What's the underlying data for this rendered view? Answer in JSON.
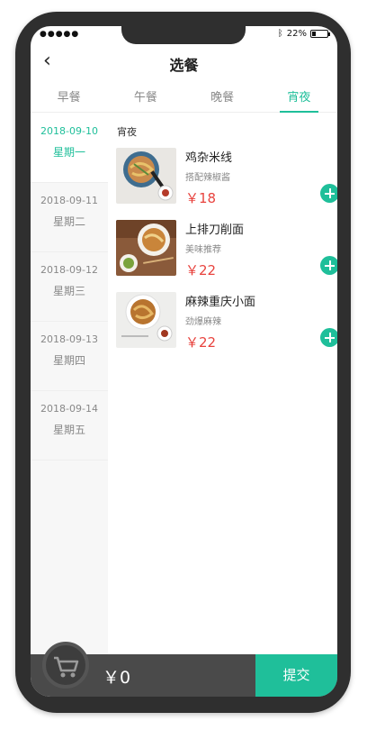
{
  "status": {
    "signal": "●●●●●",
    "battery": "22%",
    "battery_level": 0.22
  },
  "nav": {
    "back": "‹",
    "title": "选餐"
  },
  "tabs": [
    {
      "label": "早餐",
      "active": false
    },
    {
      "label": "午餐",
      "active": false
    },
    {
      "label": "晚餐",
      "active": false
    },
    {
      "label": "宵夜",
      "active": true
    }
  ],
  "dates": [
    {
      "date": "2018-09-10",
      "weekday": "星期一",
      "active": true
    },
    {
      "date": "2018-09-11",
      "weekday": "星期二",
      "active": false
    },
    {
      "date": "2018-09-12",
      "weekday": "星期三",
      "active": false
    },
    {
      "date": "2018-09-13",
      "weekday": "星期四",
      "active": false
    },
    {
      "date": "2018-09-14",
      "weekday": "星期五",
      "active": false
    }
  ],
  "section_title": "宵夜",
  "foods": [
    {
      "name": "鸡杂米线",
      "desc": "搭配辣椒酱",
      "price": "￥18"
    },
    {
      "name": "上排刀削面",
      "desc": "美味推荐",
      "price": "￥22"
    },
    {
      "name": "麻辣重庆小面",
      "desc": "劲爆麻辣",
      "price": "￥22"
    }
  ],
  "cart": {
    "total": "￥0",
    "submit": "提交"
  },
  "colors": {
    "accent": "#1fbf9a",
    "price": "#e8433e",
    "bar": "#4a4a4a"
  }
}
